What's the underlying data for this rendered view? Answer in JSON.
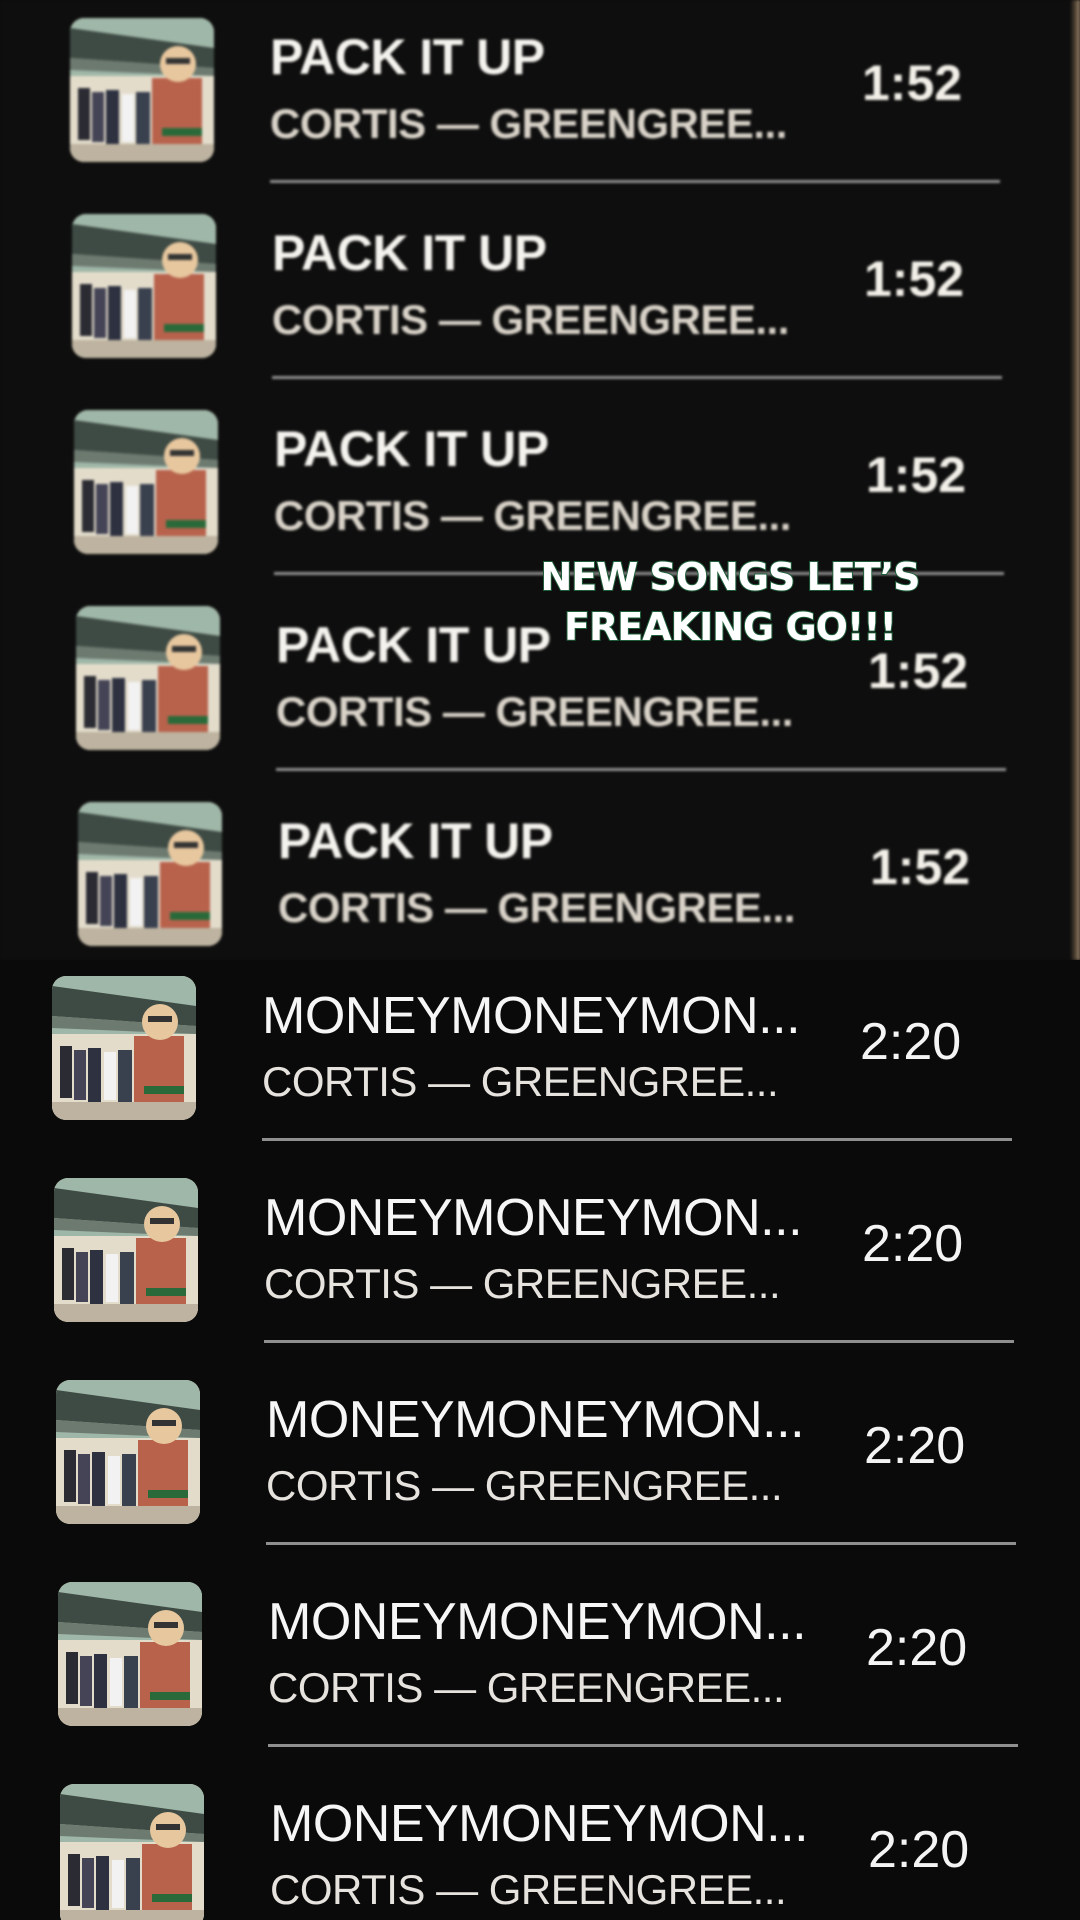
{
  "playlist": {
    "group_a": {
      "title": "PACK IT UP",
      "subtitle": "CORTIS — GREENGREE...",
      "duration": "1:52",
      "rows": 5
    },
    "group_b": {
      "title": "MONEYMONEYMON...",
      "subtitle": "CORTIS — GREENGREE...",
      "duration": "2:20",
      "rows": 5
    },
    "cover_icon": "album-cover-art"
  },
  "overlay": {
    "line1": "NEW SONGS LET’S",
    "line2": "FREAKING GO!!!",
    "stroke_color": "#1f5f3a"
  }
}
